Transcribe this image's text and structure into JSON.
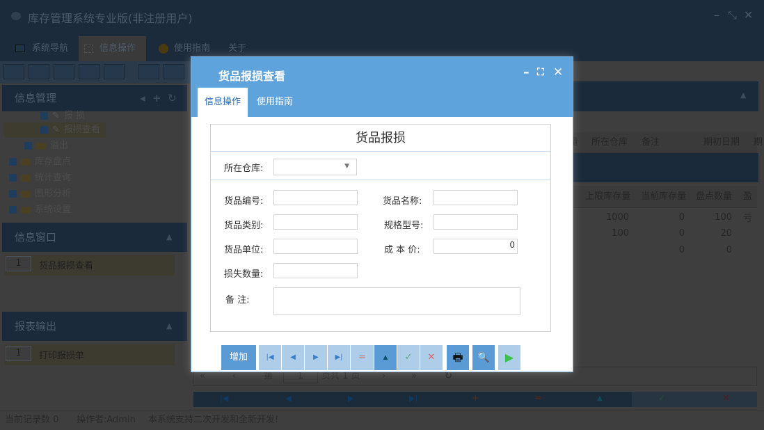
{
  "app": {
    "title": "库存管理系统专业版(非注册用户)",
    "controls": [
      "–",
      "⤡",
      "✕"
    ]
  },
  "menu": {
    "tabs": [
      "系统导航",
      "信息操作",
      "使用指南",
      "关于"
    ]
  },
  "sidebar": {
    "panel_title": "信息管理",
    "tree": [
      {
        "label": "报 损"
      },
      {
        "label": "报损查看"
      },
      {
        "label": "溢出"
      },
      {
        "label": "库存盘点"
      },
      {
        "label": "统计查询"
      },
      {
        "label": "图形分析"
      },
      {
        "label": "系统设置"
      }
    ],
    "info_window": {
      "title": "信息窗口",
      "items": [
        {
          "num": "1",
          "label": "货品报损查看"
        }
      ]
    },
    "report": {
      "title": "报表输出",
      "items": [
        {
          "num": "1",
          "label": "打印报损单"
        }
      ]
    }
  },
  "grid1": {
    "headers": [
      "量",
      "所在仓库",
      "备注",
      "期初日期",
      "期"
    ]
  },
  "grid2": {
    "headers": [
      "上限库存量",
      "当前库存量",
      "盘点数量",
      "盈亏"
    ],
    "rows": [
      [
        "1000",
        "0",
        "100"
      ],
      [
        "100",
        "0",
        "20"
      ],
      [
        "",
        "0",
        "0"
      ]
    ]
  },
  "pager": {
    "first": "«",
    "prev": "‹",
    "page_label": "第",
    "page": "1",
    "total_label": "页共 1 页",
    "next": "›",
    "last": "»"
  },
  "status": {
    "records": "当前记录数 0",
    "operator": "操作者:Admin",
    "message": "本系统支持二次开发和全新开发!"
  },
  "modal": {
    "title": "货品报损查看",
    "tabs": [
      "信息操作",
      "使用指南"
    ],
    "form_title": "货品报损",
    "warehouse_label": "所在仓库:",
    "warehouse_value": "",
    "fields": {
      "code": {
        "label": "货品编号:",
        "value": ""
      },
      "name": {
        "label": "货品名称:",
        "value": ""
      },
      "category": {
        "label": "货品类别:",
        "value": ""
      },
      "spec": {
        "label": "规格型号:",
        "value": ""
      },
      "unit": {
        "label": "货品单位:",
        "value": ""
      },
      "cost": {
        "label": "成 本 价:",
        "value": "0"
      },
      "loss_qty": {
        "label": "损失数量:",
        "value": ""
      },
      "remark": {
        "label": "备 注:",
        "value": ""
      }
    },
    "buttons": {
      "add": "增加",
      "first": "|◀",
      "prev": "◀",
      "next": "▶",
      "last": "▶|",
      "delete": "=",
      "save_up": "▲",
      "confirm": "✓",
      "cancel": "✕",
      "print": "🖶",
      "preview": "🔍",
      "run": "▶"
    }
  }
}
